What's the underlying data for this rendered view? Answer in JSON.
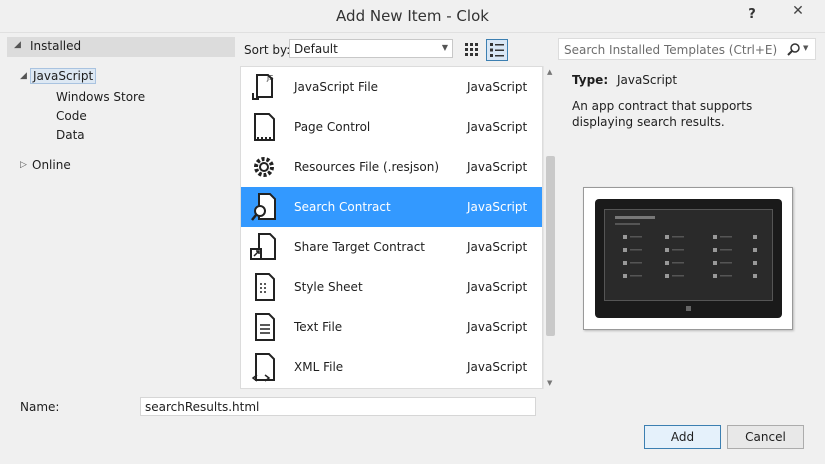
{
  "window": {
    "title": "Add New Item - Clok",
    "help": "?",
    "close": "✕"
  },
  "tree": {
    "installed": "Installed",
    "items": [
      {
        "label": "JavaScript"
      },
      {
        "label": "Windows Store"
      },
      {
        "label": "Code"
      },
      {
        "label": "Data"
      },
      {
        "label": "Online"
      }
    ]
  },
  "toolbar": {
    "sort_label": "Sort by:",
    "sort_value": "Default"
  },
  "templates": [
    {
      "name": "JavaScript File",
      "language": "JavaScript",
      "icon": "javascript-file-icon"
    },
    {
      "name": "Page Control",
      "language": "JavaScript",
      "icon": "page-control-icon"
    },
    {
      "name": "Resources File (.resjson)",
      "language": "JavaScript",
      "icon": "resources-gear-icon"
    },
    {
      "name": "Search Contract",
      "language": "JavaScript",
      "icon": "search-contract-icon"
    },
    {
      "name": "Share Target Contract",
      "language": "JavaScript",
      "icon": "share-target-icon"
    },
    {
      "name": "Style Sheet",
      "language": "JavaScript",
      "icon": "style-sheet-icon"
    },
    {
      "name": "Text File",
      "language": "JavaScript",
      "icon": "text-file-icon"
    },
    {
      "name": "XML File",
      "language": "JavaScript",
      "icon": "xml-file-icon"
    }
  ],
  "search": {
    "placeholder": "Search Installed Templates (Ctrl+E)"
  },
  "details": {
    "type_label": "Type:",
    "type_value": "JavaScript",
    "description": "An app contract that supports displaying search results."
  },
  "footer": {
    "name_label": "Name:",
    "name_value": "searchResults.html",
    "add_label": "Add",
    "cancel_label": "Cancel"
  },
  "colors": {
    "selection": "#3399ff",
    "accent": "#3c7fb1"
  }
}
